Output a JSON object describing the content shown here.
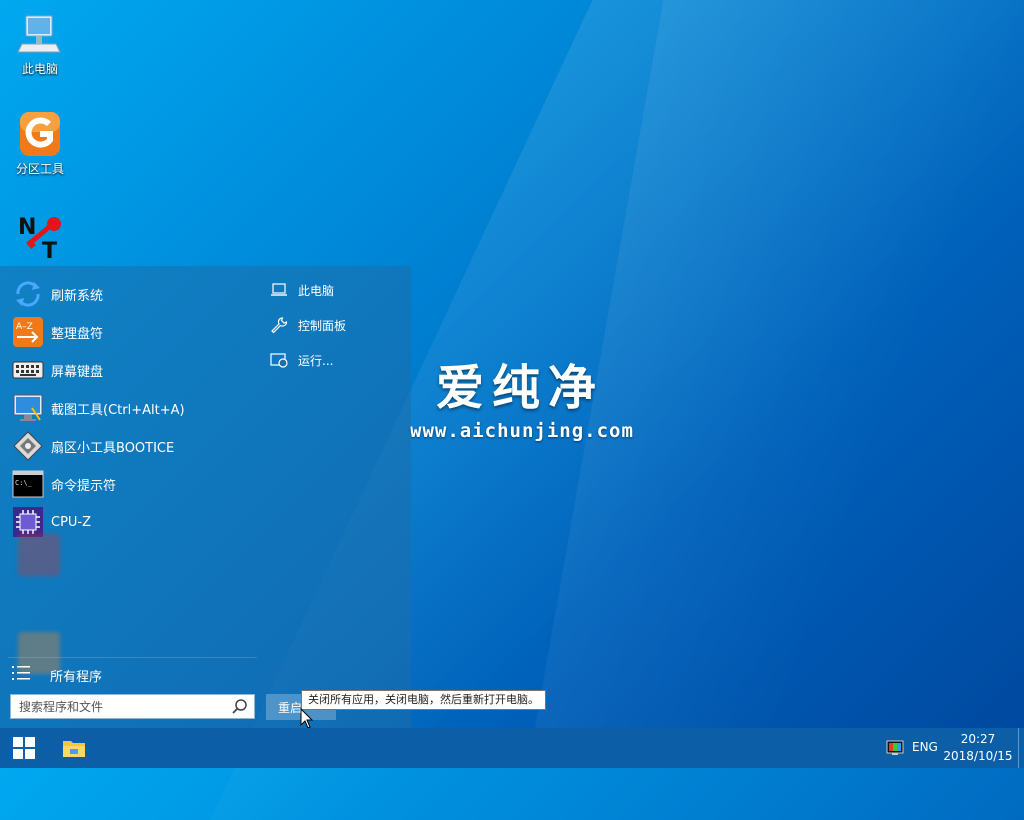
{
  "desktop": {
    "icons": [
      {
        "label": "此电脑"
      },
      {
        "label": "分区工具"
      },
      {
        "label": ""
      }
    ],
    "brand": {
      "name": "爱纯净",
      "url": "www.aichunjing.com"
    }
  },
  "start_menu": {
    "apps": [
      {
        "label": "刷新系统"
      },
      {
        "label": "整理盘符"
      },
      {
        "label": "屏幕键盘"
      },
      {
        "label": "截图工具(Ctrl+Alt+A)"
      },
      {
        "label": "扇区小工具BOOTICE"
      },
      {
        "label": "命令提示符"
      },
      {
        "label": "CPU-Z"
      }
    ],
    "all_programs": "所有程序",
    "search_placeholder": "搜索程序和文件",
    "right": [
      {
        "label": "此电脑"
      },
      {
        "label": "控制面板"
      },
      {
        "label": "运行..."
      }
    ],
    "restart_label": "重启",
    "tooltip": "关闭所有应用，关闭电脑，然后重新打开电脑。"
  },
  "taskbar": {
    "lang": "ENG",
    "time": "20:27",
    "date": "2018/10/15"
  },
  "colors": {
    "desktop_accent": "#0086d6",
    "taskbar": "#0c5fa6"
  }
}
